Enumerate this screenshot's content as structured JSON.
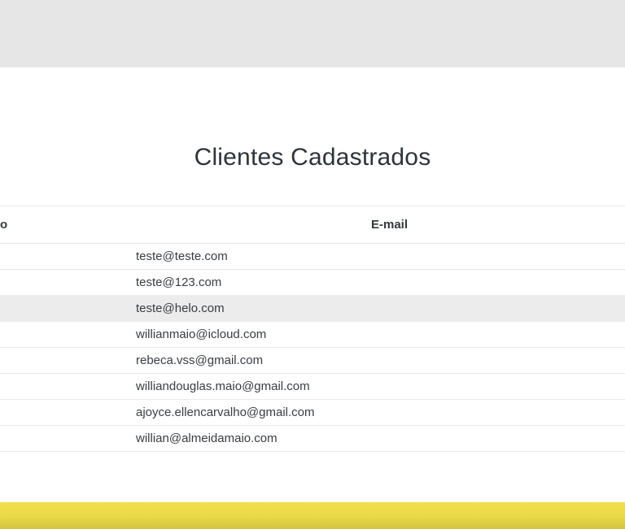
{
  "page": {
    "title": "Clientes Cadastrados"
  },
  "table": {
    "partial_first_column_header": "o",
    "email_header": "E-mail",
    "rows": [
      {
        "email": "teste@teste.com",
        "highlighted": false
      },
      {
        "email": "teste@123.com",
        "highlighted": false
      },
      {
        "email": "teste@helo.com",
        "highlighted": true
      },
      {
        "email": "willianmaio@icloud.com",
        "highlighted": false
      },
      {
        "email": "rebeca.vss@gmail.com",
        "highlighted": false
      },
      {
        "email": "williandouglas.maio@gmail.com",
        "highlighted": false
      },
      {
        "email": "ajoyce.ellencarvalho@gmail.com",
        "highlighted": false
      },
      {
        "email": "willian@almeidamaio.com",
        "highlighted": false
      }
    ]
  },
  "colors": {
    "top_band": "#e6e6e6",
    "row_highlight": "#ececec",
    "divider": "#e8eaec",
    "title_text": "#2d3439",
    "body_text": "#383d42",
    "footer_yellow_top": "#f1df4e",
    "footer_yellow_bottom": "#d3c33e"
  }
}
